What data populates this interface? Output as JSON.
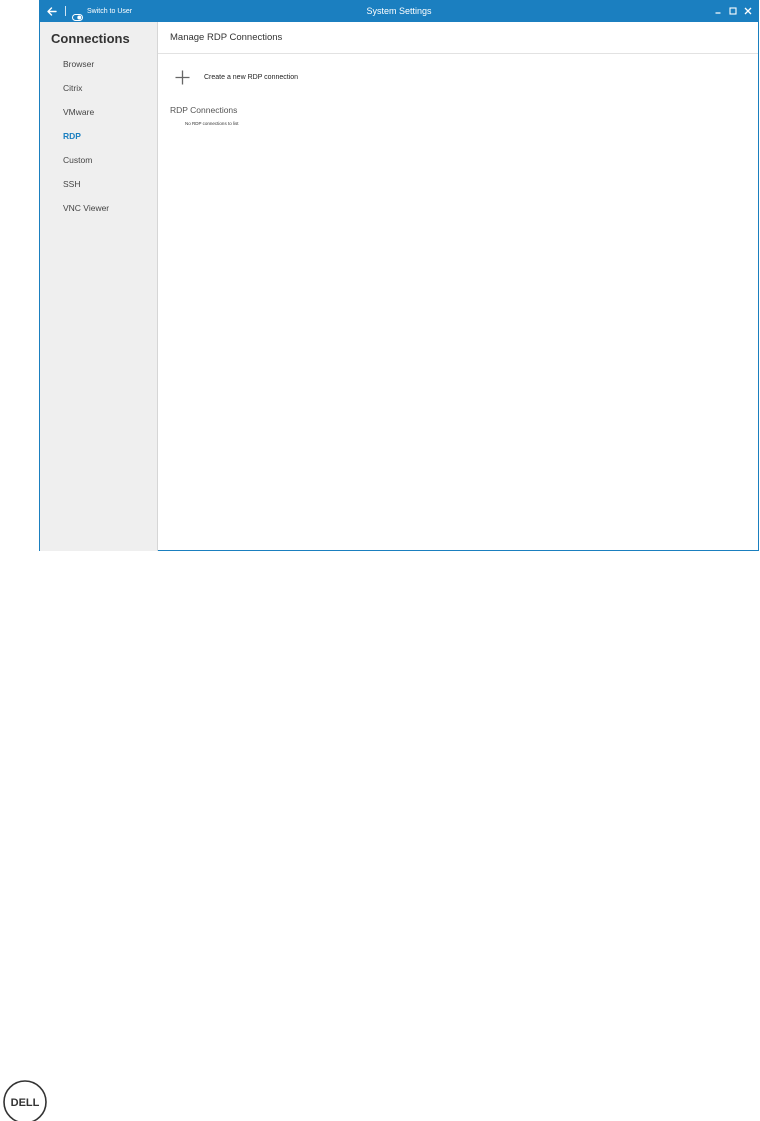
{
  "window": {
    "title": "System Settings",
    "switch_label": "Switch to User"
  },
  "sidebar": {
    "title": "Connections",
    "items": [
      {
        "label": "Browser"
      },
      {
        "label": "Citrix"
      },
      {
        "label": "VMware"
      },
      {
        "label": "RDP",
        "active": true
      },
      {
        "label": "Custom"
      },
      {
        "label": "SSH"
      },
      {
        "label": "VNC Viewer"
      }
    ]
  },
  "main": {
    "title": "Manage RDP Connections",
    "create_label": "Create a new RDP connection",
    "section_title": "RDP Connections",
    "empty_message": "No RDP connections to list"
  },
  "logo": {
    "text": "DELL"
  },
  "icons": {
    "back": "arrow-left-icon",
    "toggle": "toggle-icon",
    "minimize": "minimize-icon",
    "maximize": "maximize-icon",
    "close": "close-icon",
    "plus": "plus-icon"
  },
  "colors": {
    "titlebar": "#1b7fc0",
    "active_nav": "#1b7fc0",
    "sidebar_bg": "#efefef"
  }
}
